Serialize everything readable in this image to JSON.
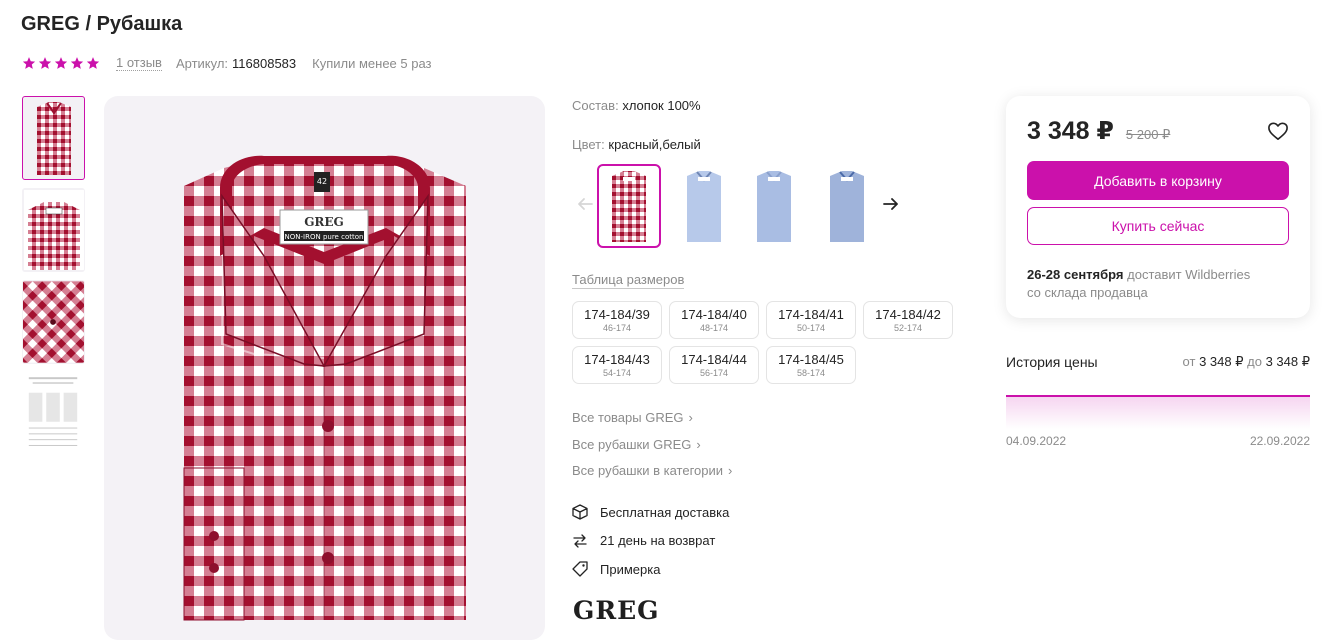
{
  "product": {
    "title": "GREG / Рубашка",
    "rating_stars": 5,
    "reviews": "1 отзыв",
    "sku_label": "Артикул:",
    "sku_value": "116808583",
    "purchases": "Купили менее 5 раз"
  },
  "details": {
    "composition_label": "Состав:",
    "composition_value": "хлопок 100%",
    "color_label": "Цвет:",
    "color_value": "красный,белый",
    "size_table": "Таблица размеров",
    "sizes": [
      {
        "size": "174-184/39",
        "sub": "46-174"
      },
      {
        "size": "174-184/40",
        "sub": "48-174"
      },
      {
        "size": "174-184/41",
        "sub": "50-174"
      },
      {
        "size": "174-184/42",
        "sub": "52-174"
      },
      {
        "size": "174-184/43",
        "sub": "54-174"
      },
      {
        "size": "174-184/44",
        "sub": "56-174"
      },
      {
        "size": "174-184/45",
        "sub": "58-174"
      }
    ],
    "links": [
      "Все товары GREG",
      "Все рубашки GREG",
      "Все рубашки в категории"
    ],
    "features": [
      "Бесплатная доставка",
      "21 день на возврат",
      "Примерка"
    ],
    "brand": "GREG"
  },
  "buy": {
    "price": "3 348 ₽",
    "old_price": "5 200 ₽",
    "add_to_cart": "Добавить в корзину",
    "buy_now": "Купить сейчас",
    "delivery_dates": "26-28 сентября",
    "delivery_by": "доставит Wildberries",
    "delivery_from": "со склада продавца"
  },
  "history": {
    "title": "История цены",
    "from_label": "от",
    "from_value": "3 348 ₽",
    "to_label": "до",
    "to_value": "3 348 ₽",
    "date_start": "04.09.2022",
    "date_end": "22.09.2022"
  },
  "shirt_label": {
    "brand": "GREG",
    "tag": "NON-IRON pure cotton",
    "size": "42"
  },
  "colors": {
    "accent": "#cb11ab",
    "shirt_red": "#b3153a",
    "shirt_blue": "#a9c0e6"
  }
}
